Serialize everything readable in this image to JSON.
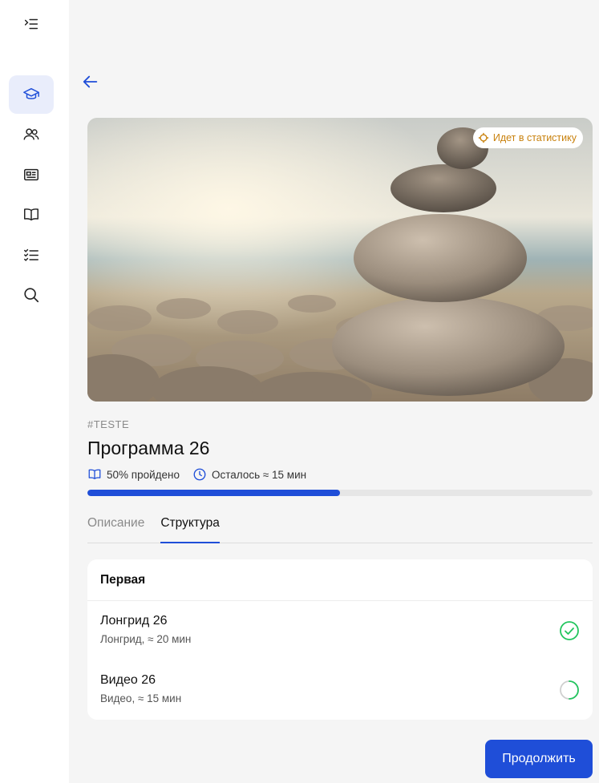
{
  "sidebar": {
    "items": [
      {
        "icon": "expand-menu-icon"
      },
      {
        "icon": "graduation-cap-icon",
        "active": true
      },
      {
        "icon": "users-icon"
      },
      {
        "icon": "newspaper-icon"
      },
      {
        "icon": "book-icon"
      },
      {
        "icon": "checklist-icon"
      },
      {
        "icon": "search-icon"
      }
    ]
  },
  "hero": {
    "badge": "Идет в статистику",
    "badge_color": "#c9820e"
  },
  "program": {
    "tag": "#TESTE",
    "title": "Программа 26",
    "progress_label": "50% пройдено",
    "progress_fraction": 0.5,
    "time_left": "Осталось ≈ 15 мин"
  },
  "tabs": [
    "Описание",
    "Структура"
  ],
  "active_tab": 1,
  "section": {
    "title": "Первая",
    "lessons": [
      {
        "title": "Лонгрид 26",
        "subtitle": "Лонгрид, ≈ 20 мин",
        "status": "completed"
      },
      {
        "title": "Видео 26",
        "subtitle": "Видео, ≈ 15 мин",
        "status": "in-progress"
      }
    ]
  },
  "actions": {
    "continue_label": "Продолжить"
  },
  "colors": {
    "accent": "#1f4ed8",
    "success": "#22c55e",
    "badge": "#c9820e"
  }
}
